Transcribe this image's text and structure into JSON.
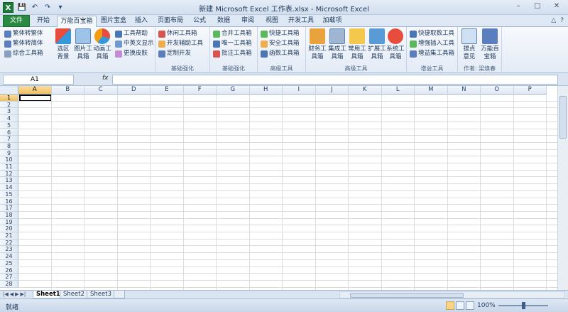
{
  "title": "新建 Microsoft Excel 工作表.xlsx - Microsoft Excel",
  "window_controls": {
    "minimize": "–",
    "maximize": "□",
    "close": "✕"
  },
  "quick_access": {
    "save": "💾",
    "undo": "↶",
    "redo": "↷",
    "customize": "▾"
  },
  "tabs": [
    "文件",
    "开始",
    "万能百宝箱",
    "图片宝盒",
    "插入",
    "页面布局",
    "公式",
    "数据",
    "审阅",
    "视图",
    "开发工具",
    "加载项"
  ],
  "tab_right": {
    "help": "?",
    "minimize_ribbon": "△"
  },
  "ribbon": {
    "group1": {
      "items": [
        "繁体转繁体",
        "繁体转简体",
        "综合工具箱"
      ],
      "big": [
        "选区\n背景",
        "图片工\n具箱",
        "动画工\n具箱"
      ],
      "right": [
        "工具帮助",
        "中英文显示",
        "更换皮肤"
      ]
    },
    "group2": {
      "label": "基础强化",
      "items": [
        "休闲工具箱",
        "开发辅助工具",
        "定制开发"
      ]
    },
    "group3": {
      "label": "基础强化",
      "items": [
        "合并工具箱",
        "唯一工具箱",
        "批注工具箱"
      ]
    },
    "group4": {
      "label": "高级工具",
      "items": [
        "快捷工具箱",
        "安全工具箱",
        "函数工具箱"
      ]
    },
    "group5": {
      "label": "高级工具",
      "big": [
        "财务工\n具箱",
        "集成工\n具箱",
        "常用工\n具箱",
        "扩展工\n具箱",
        "系统工\n具箱"
      ]
    },
    "group6": {
      "label": "增益工具",
      "items": [
        "快捷取数工具",
        "增强插入工具",
        "增益集工具箱"
      ]
    },
    "group7": {
      "label": "作者: 梁焕春",
      "big": [
        "提点\n意见",
        "万能百\n宝箱"
      ]
    }
  },
  "formula_bar": {
    "name_box": "A1",
    "fx": "fx",
    "content": ""
  },
  "columns": [
    "A",
    "B",
    "C",
    "D",
    "E",
    "F",
    "G",
    "H",
    "I",
    "J",
    "K",
    "L",
    "M",
    "N",
    "O",
    "P"
  ],
  "rows": [
    "1",
    "2",
    "3",
    "4",
    "5",
    "6",
    "7",
    "8",
    "9",
    "10",
    "11",
    "12",
    "13",
    "14",
    "15",
    "16",
    "17",
    "18",
    "19",
    "20",
    "21",
    "22",
    "23",
    "24",
    "25",
    "26",
    "27",
    "28"
  ],
  "sheets": [
    "Sheet1",
    "Sheet2",
    "Sheet3"
  ],
  "status": {
    "ready": "就绪",
    "zoom": "100%"
  }
}
